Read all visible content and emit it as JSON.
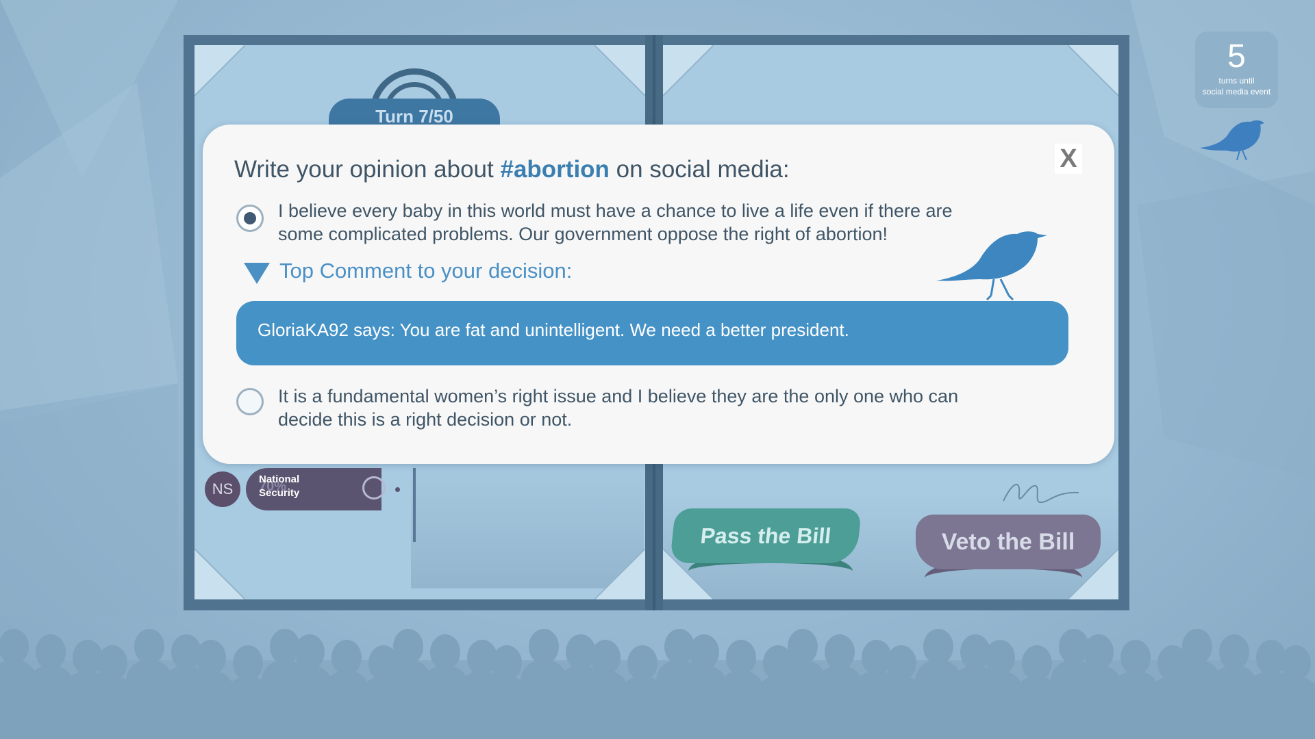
{
  "game": {
    "turn_label": "Turn 7/50",
    "counter": {
      "number": "5",
      "caption_line1": "turns until",
      "caption_line2": "social media event"
    }
  },
  "stat": {
    "abbr": "NS",
    "label_line1": "National",
    "label_line2": "Security",
    "percent": "70%"
  },
  "bill": {
    "pass_label": "Pass the Bill",
    "veto_label": "Veto the Bill"
  },
  "modal": {
    "title_prefix": "Write your opinion about ",
    "title_tag": "#abortion",
    "title_suffix": " on social media:",
    "close_label": "X",
    "options": [
      {
        "line1": "I believe every baby in this world must have a chance to live a life even if there are",
        "line2": "some complicated problems. Our government oppose the right of abortion!",
        "selected": true
      },
      {
        "line1": "It is a fundamental women’s right issue and I believe they are the only one who can",
        "line2": "decide this is a right decision or not.",
        "selected": false
      }
    ],
    "top_comment_label": "Top Comment to your decision:",
    "top_comment": "GloriaKA92 says: You are fat and unintelligent. We need a better president."
  },
  "colors": {
    "accent": "#4592c7",
    "text": "#3f5566",
    "hashtag": "#3b7fb0",
    "pass": "#4e9e98",
    "veto": "#7c7692"
  },
  "icons": [
    "bird-icon",
    "close-icon",
    "radio-selected-icon",
    "radio-empty-icon",
    "triangle-down-icon",
    "signature-icon"
  ]
}
